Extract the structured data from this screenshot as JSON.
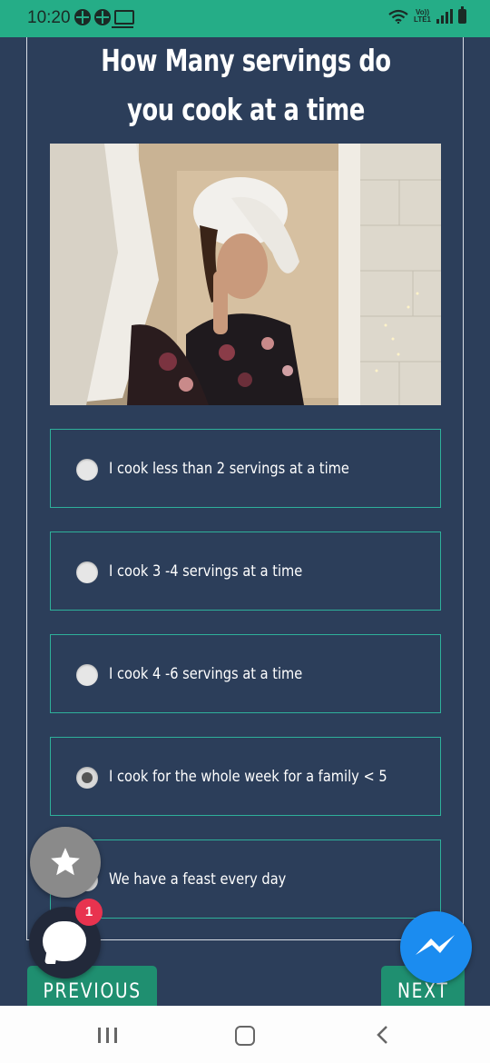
{
  "status_bar": {
    "time": "10:20",
    "left_icons": [
      "status-app-icon",
      "status-app-icon",
      "laptop-icon"
    ],
    "volte_top": "Vo))",
    "volte_bottom": "LTE1",
    "right_icons": [
      "wifi-icon",
      "signal-icon",
      "battery-icon"
    ],
    "background": "#25ad87"
  },
  "question": {
    "title": "How Many servings do you cook at a time"
  },
  "options": [
    {
      "label": "I cook less than 2 servings at a time",
      "selected": false
    },
    {
      "label": "I cook 3 -4 servings at a time",
      "selected": false
    },
    {
      "label": "I cook 4 -6 servings at a time",
      "selected": false
    },
    {
      "label": "I cook for the whole week for a family < 5",
      "selected": true
    },
    {
      "label": "We have a feast every day",
      "selected": false
    }
  ],
  "navigation": {
    "previous_label": "PREVIOUS",
    "next_label": "NEXT"
  },
  "floating": {
    "star_icon": "star-icon",
    "chat_icon": "chat-icon",
    "chat_badge": "1",
    "messenger_icon": "messenger-icon"
  },
  "android_nav": [
    "recents-icon",
    "home-icon",
    "back-icon"
  ],
  "colors": {
    "background": "#2c3e5a",
    "option_border": "#2eb09a",
    "button": "#1f8f70",
    "badge": "#e8334f",
    "messenger": "#1b8cf0"
  }
}
